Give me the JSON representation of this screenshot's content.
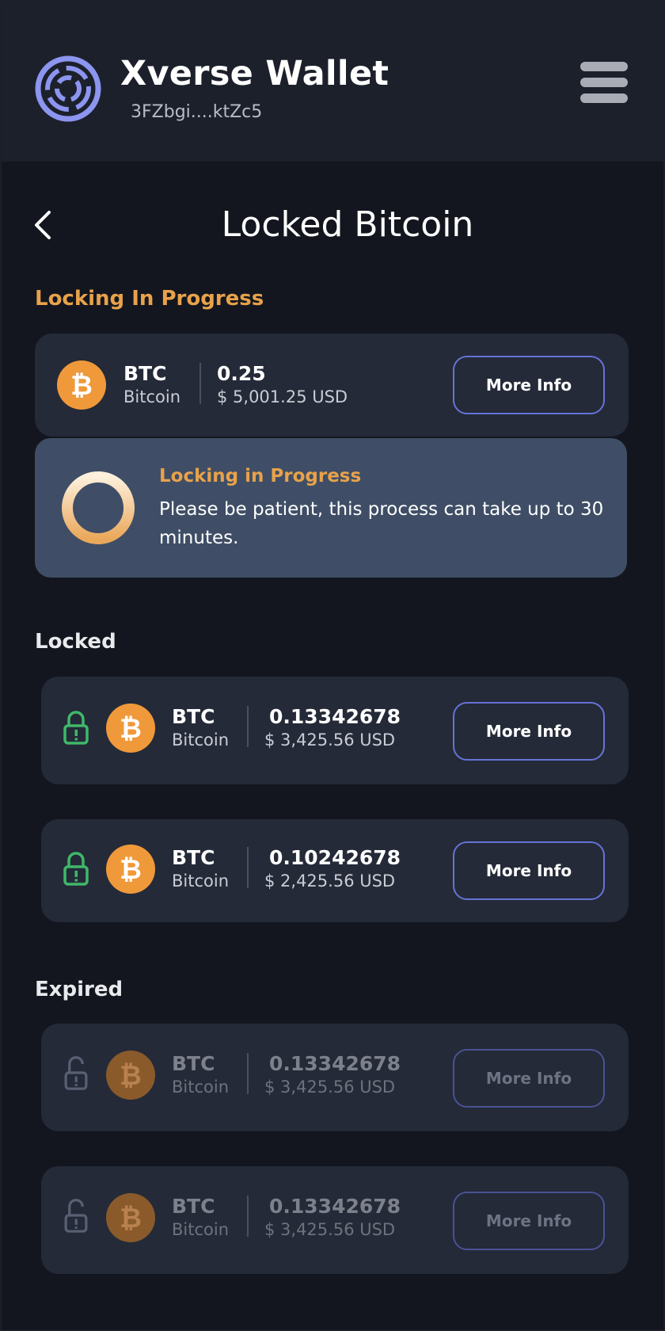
{
  "header": {
    "app_title": "Xverse Wallet",
    "address": "3FZbgi....ktZc5"
  },
  "page": {
    "title": "Locked Bitcoin"
  },
  "sections": {
    "in_progress": "Locking In Progress",
    "locked": "Locked",
    "expired": "Expired"
  },
  "in_progress_card": {
    "ticker": "BTC",
    "name": "Bitcoin",
    "amount": "0.25",
    "usd": "$ 5,001.25 USD",
    "button": "More Info"
  },
  "progress_notice": {
    "title": "Locking in Progress",
    "text": "Please be patient, this process can take up to 30 minutes.",
    "progress_fraction": 0.5
  },
  "locked_cards": [
    {
      "ticker": "BTC",
      "name": "Bitcoin",
      "amount": "0.13342678",
      "usd": "$ 3,425.56 USD",
      "button": "More Info"
    },
    {
      "ticker": "BTC",
      "name": "Bitcoin",
      "amount": "0.10242678",
      "usd": "$ 2,425.56 USD",
      "button": "More Info"
    }
  ],
  "expired_cards": [
    {
      "ticker": "BTC",
      "name": "Bitcoin",
      "amount": "0.13342678",
      "usd": "$ 3,425.56 USD",
      "button": "More Info"
    },
    {
      "ticker": "BTC",
      "name": "Bitcoin",
      "amount": "0.13342678",
      "usd": "$ 3,425.56 USD",
      "button": "More Info"
    }
  ],
  "colors": {
    "accent_orange": "#e8a24a",
    "button_border": "#6673d6",
    "lock_green": "#3fb86a",
    "bitcoin_orange": "#f0993a"
  },
  "icons": {
    "logo": "xverse-logo-icon",
    "menu": "hamburger-menu-icon",
    "back": "chevron-left-icon",
    "coin": "bitcoin-icon",
    "locked": "lock-closed-icon",
    "expired": "lock-open-icon"
  }
}
